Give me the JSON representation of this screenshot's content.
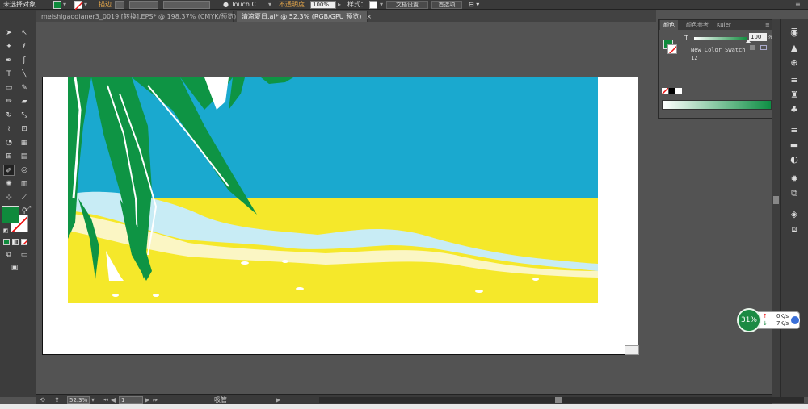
{
  "control_bar": {
    "selection_label": "未选择对象",
    "stroke_label": "描边",
    "brush_name": "Touch C...",
    "opacity_label": "不透明度",
    "opacity_value": "100%",
    "style_label": "样式：",
    "doc_setup_label": "文档设置",
    "prefs_label": "首选项"
  },
  "tabs": [
    {
      "label": "meishigaodianer3_0019 [转换].EPS* @ 198.37% (CMYK/预览)",
      "close": "×"
    },
    {
      "label": "清凉夏日.ai* @ 52.3% (RGB/GPU 预览)",
      "close": "×"
    }
  ],
  "color_panel": {
    "tabs": [
      "颜色",
      "颜色参考",
      "Kuler"
    ],
    "channel_label": "T",
    "tint_value": "100",
    "percent": "%",
    "swatch_name": "New Color Swatch",
    "swatch_number": "12"
  },
  "status_bar": {
    "zoom_value": "52.3%",
    "page_value": "1",
    "tool_name": "吸管"
  },
  "net_widget": {
    "cpu_percent": "31%",
    "upload": "0K/s",
    "download": "7K/s"
  },
  "colors": {
    "fill": "#0f8a3c",
    "sky": "#1aa9cf",
    "sand": "#f5e82a",
    "palm": "#0e9444",
    "accent_green": "#0e8f44"
  },
  "icons": {
    "dock": [
      "hamburger-icon",
      "color-wheel-icon",
      "image-icon",
      "globe-icon",
      "brush-icon",
      "club-icon",
      "lines-icon",
      "gradient-icon",
      "appearance-icon",
      "graphic-style-icon",
      "artboard-icon",
      "layers-icon",
      "transform-icon"
    ]
  }
}
